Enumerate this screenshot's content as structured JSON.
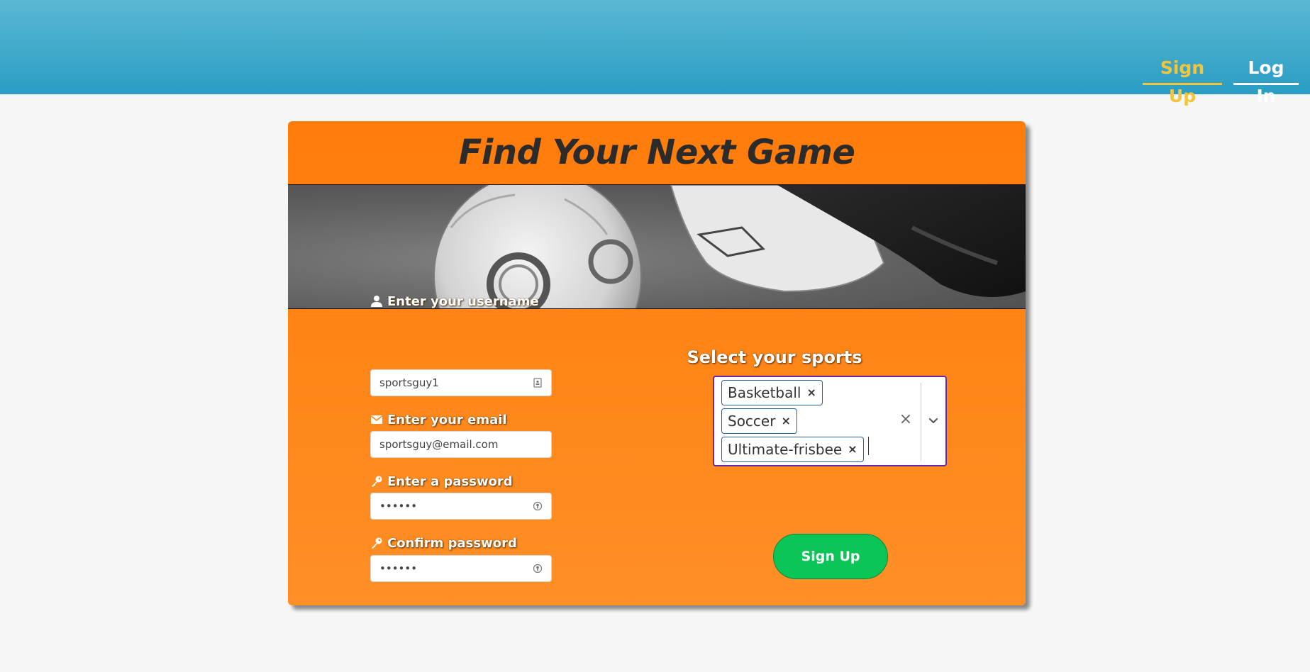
{
  "nav": {
    "signup_label": "Sign Up",
    "login_label": "Log In"
  },
  "card": {
    "title": "Find Your Next Game"
  },
  "form": {
    "username_label": "Enter your username",
    "username_value": "sportsguy1",
    "email_label": "Enter your email",
    "email_value": "sportsguy@email.com",
    "password_label": "Enter a password",
    "password_value": "••••••",
    "confirm_label": "Confirm password",
    "confirm_value": "••••••"
  },
  "sports": {
    "title": "Select your sports",
    "selected": [
      "Basketball",
      "Soccer",
      "Ultimate-frisbee"
    ],
    "remove_glyph": "×",
    "clear_glyph": "×"
  },
  "submit": {
    "label": "Sign Up"
  },
  "colors": {
    "nav_active": "#f2c53d",
    "card_orange": "#ff7c0a",
    "button_green": "#0bc656",
    "select_border": "#6a2aa6"
  }
}
